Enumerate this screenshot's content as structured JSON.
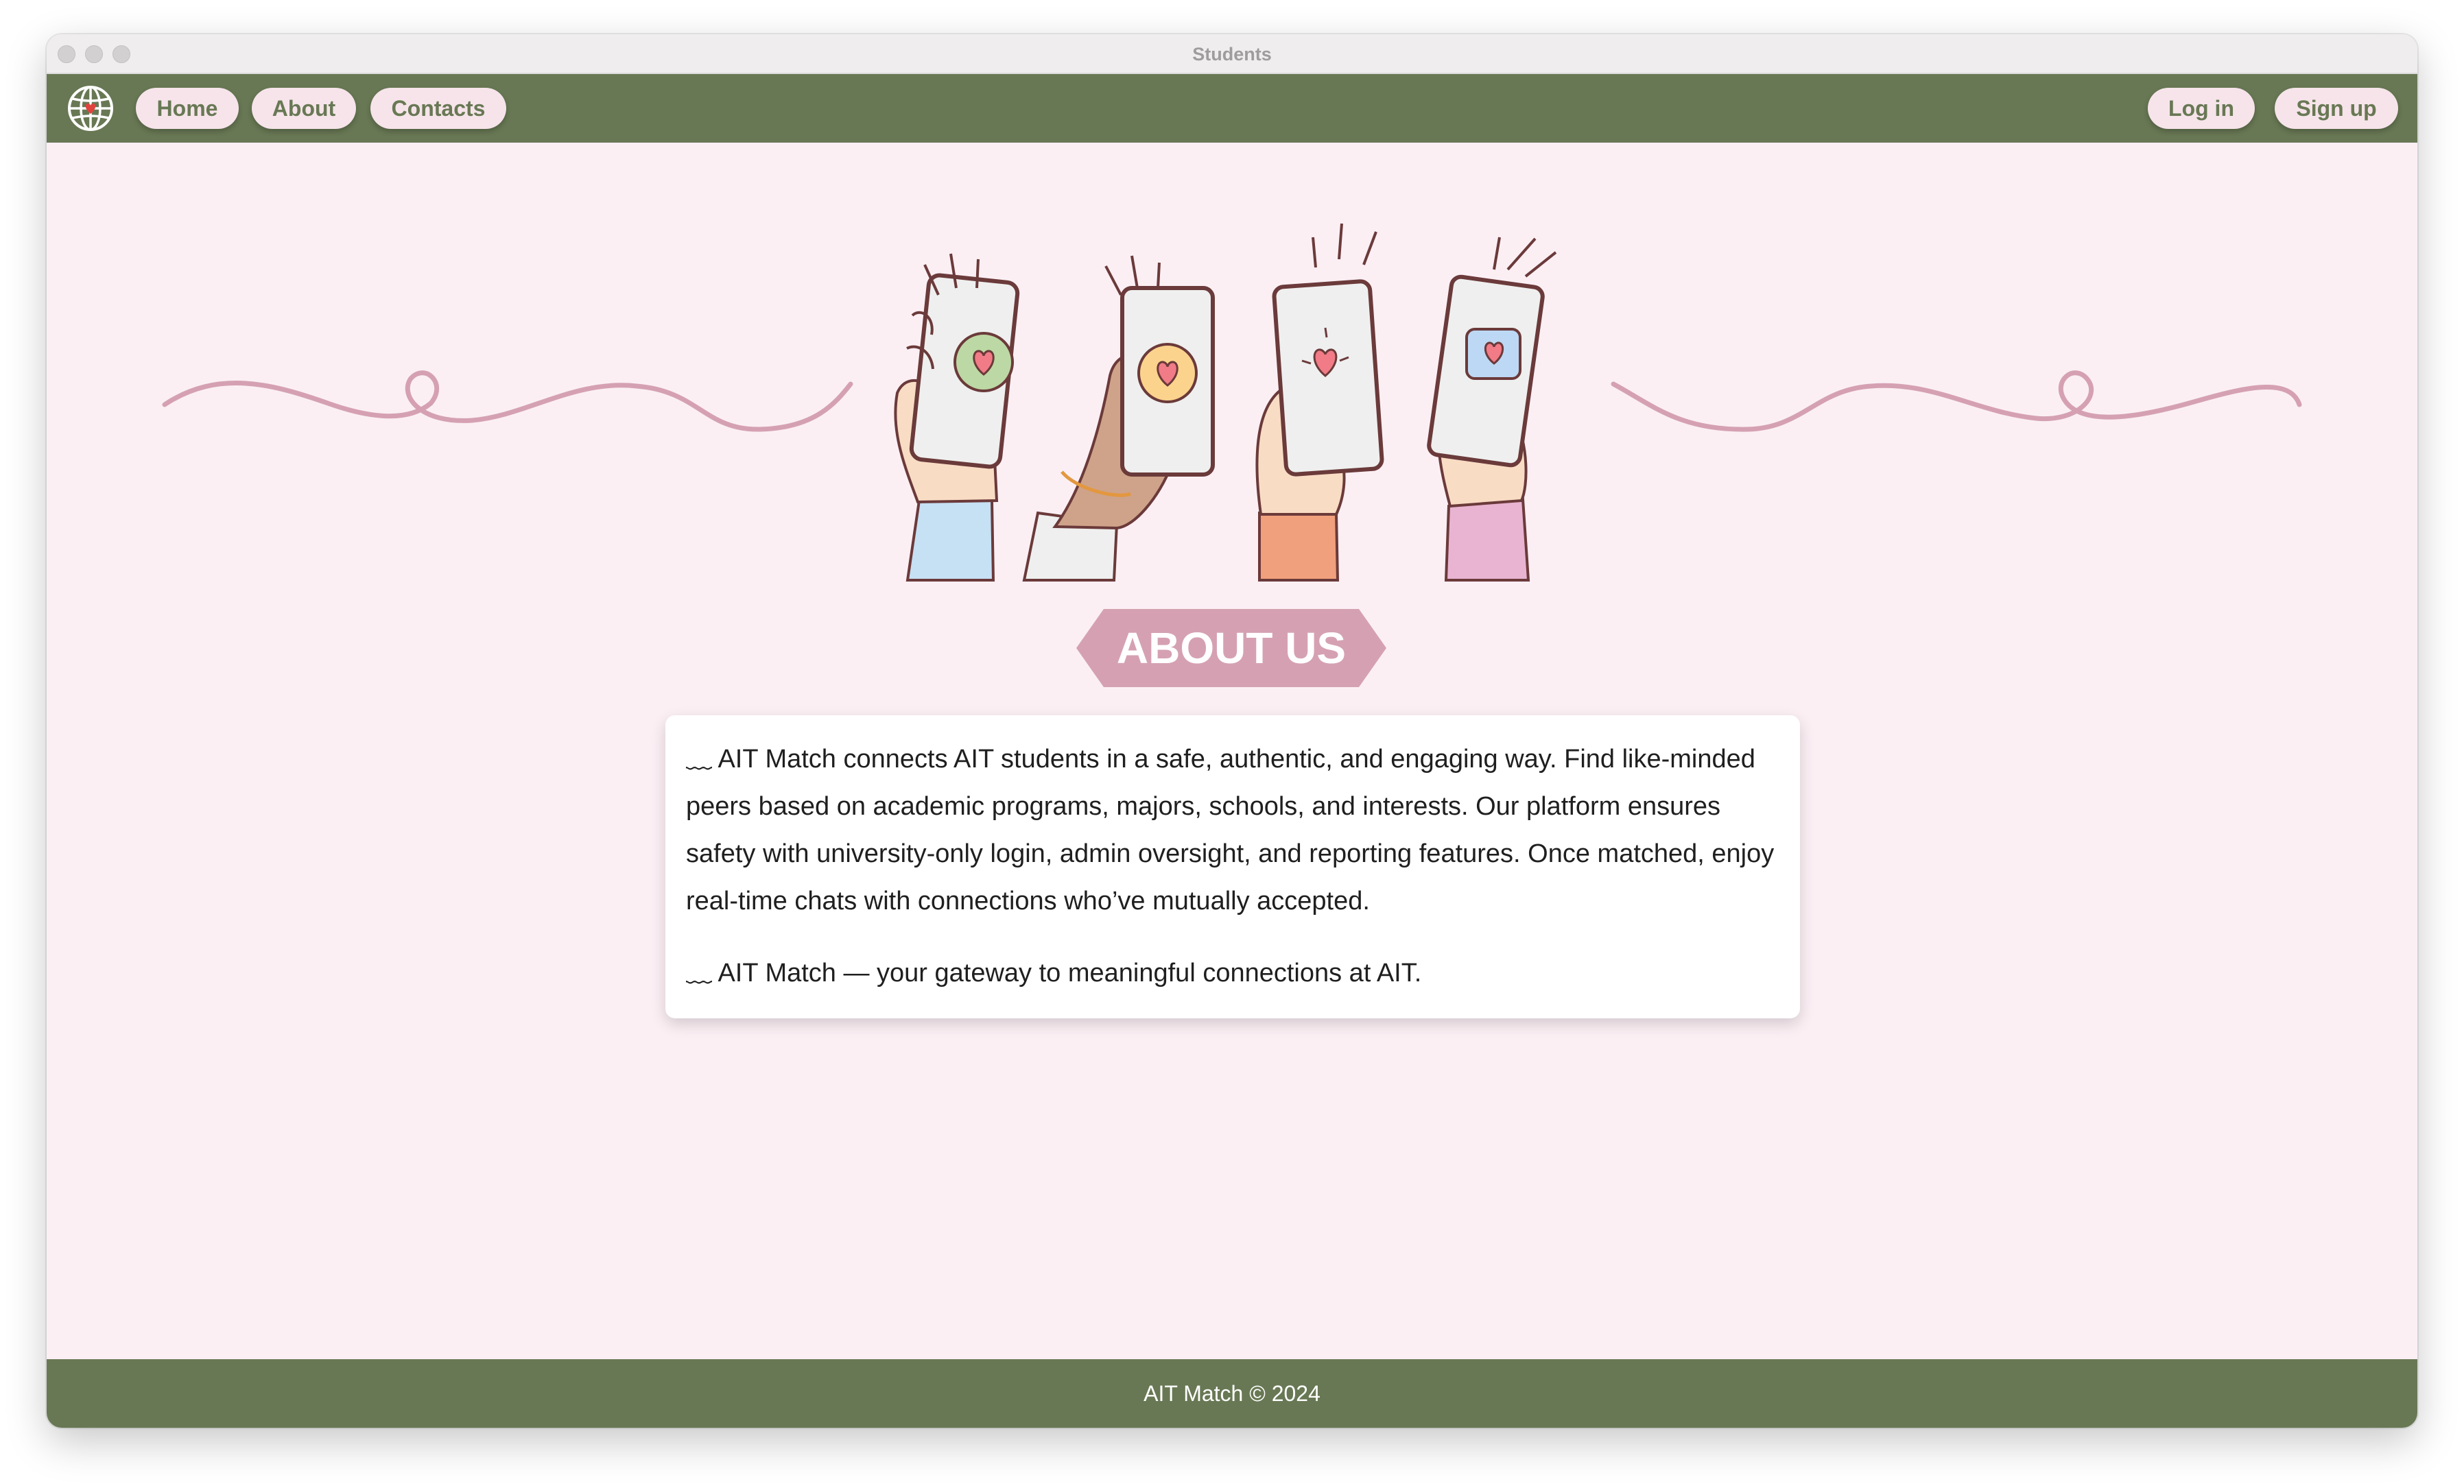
{
  "window": {
    "title": "Students"
  },
  "nav": {
    "home_label": "Home",
    "about_label": "About",
    "contacts_label": "Contacts",
    "login_label": "Log in",
    "signup_label": "Sign up",
    "logo_icon": "globe-heart-icon"
  },
  "about": {
    "heading": "ABOUT US",
    "paragraph1": "﹏ AIT Match connects AIT students in a safe, authentic, and engaging way. Find like-minded peers based on academic programs, majors, schools, and interests. Our platform ensures safety with university-only login, admin oversight, and reporting features. Once matched, enjoy real-time chats with connections who’ve mutually accepted.",
    "paragraph2": "﹏ AIT Match — your gateway to meaningful connections at AIT."
  },
  "footer": {
    "text": "AIT Match © 2024"
  },
  "colors": {
    "nav_bg": "#687854",
    "page_bg": "#fbeff4",
    "pill_bg": "#f6e4ea",
    "accent_pink": "#d5a1b2",
    "footer_bg": "#687854"
  }
}
